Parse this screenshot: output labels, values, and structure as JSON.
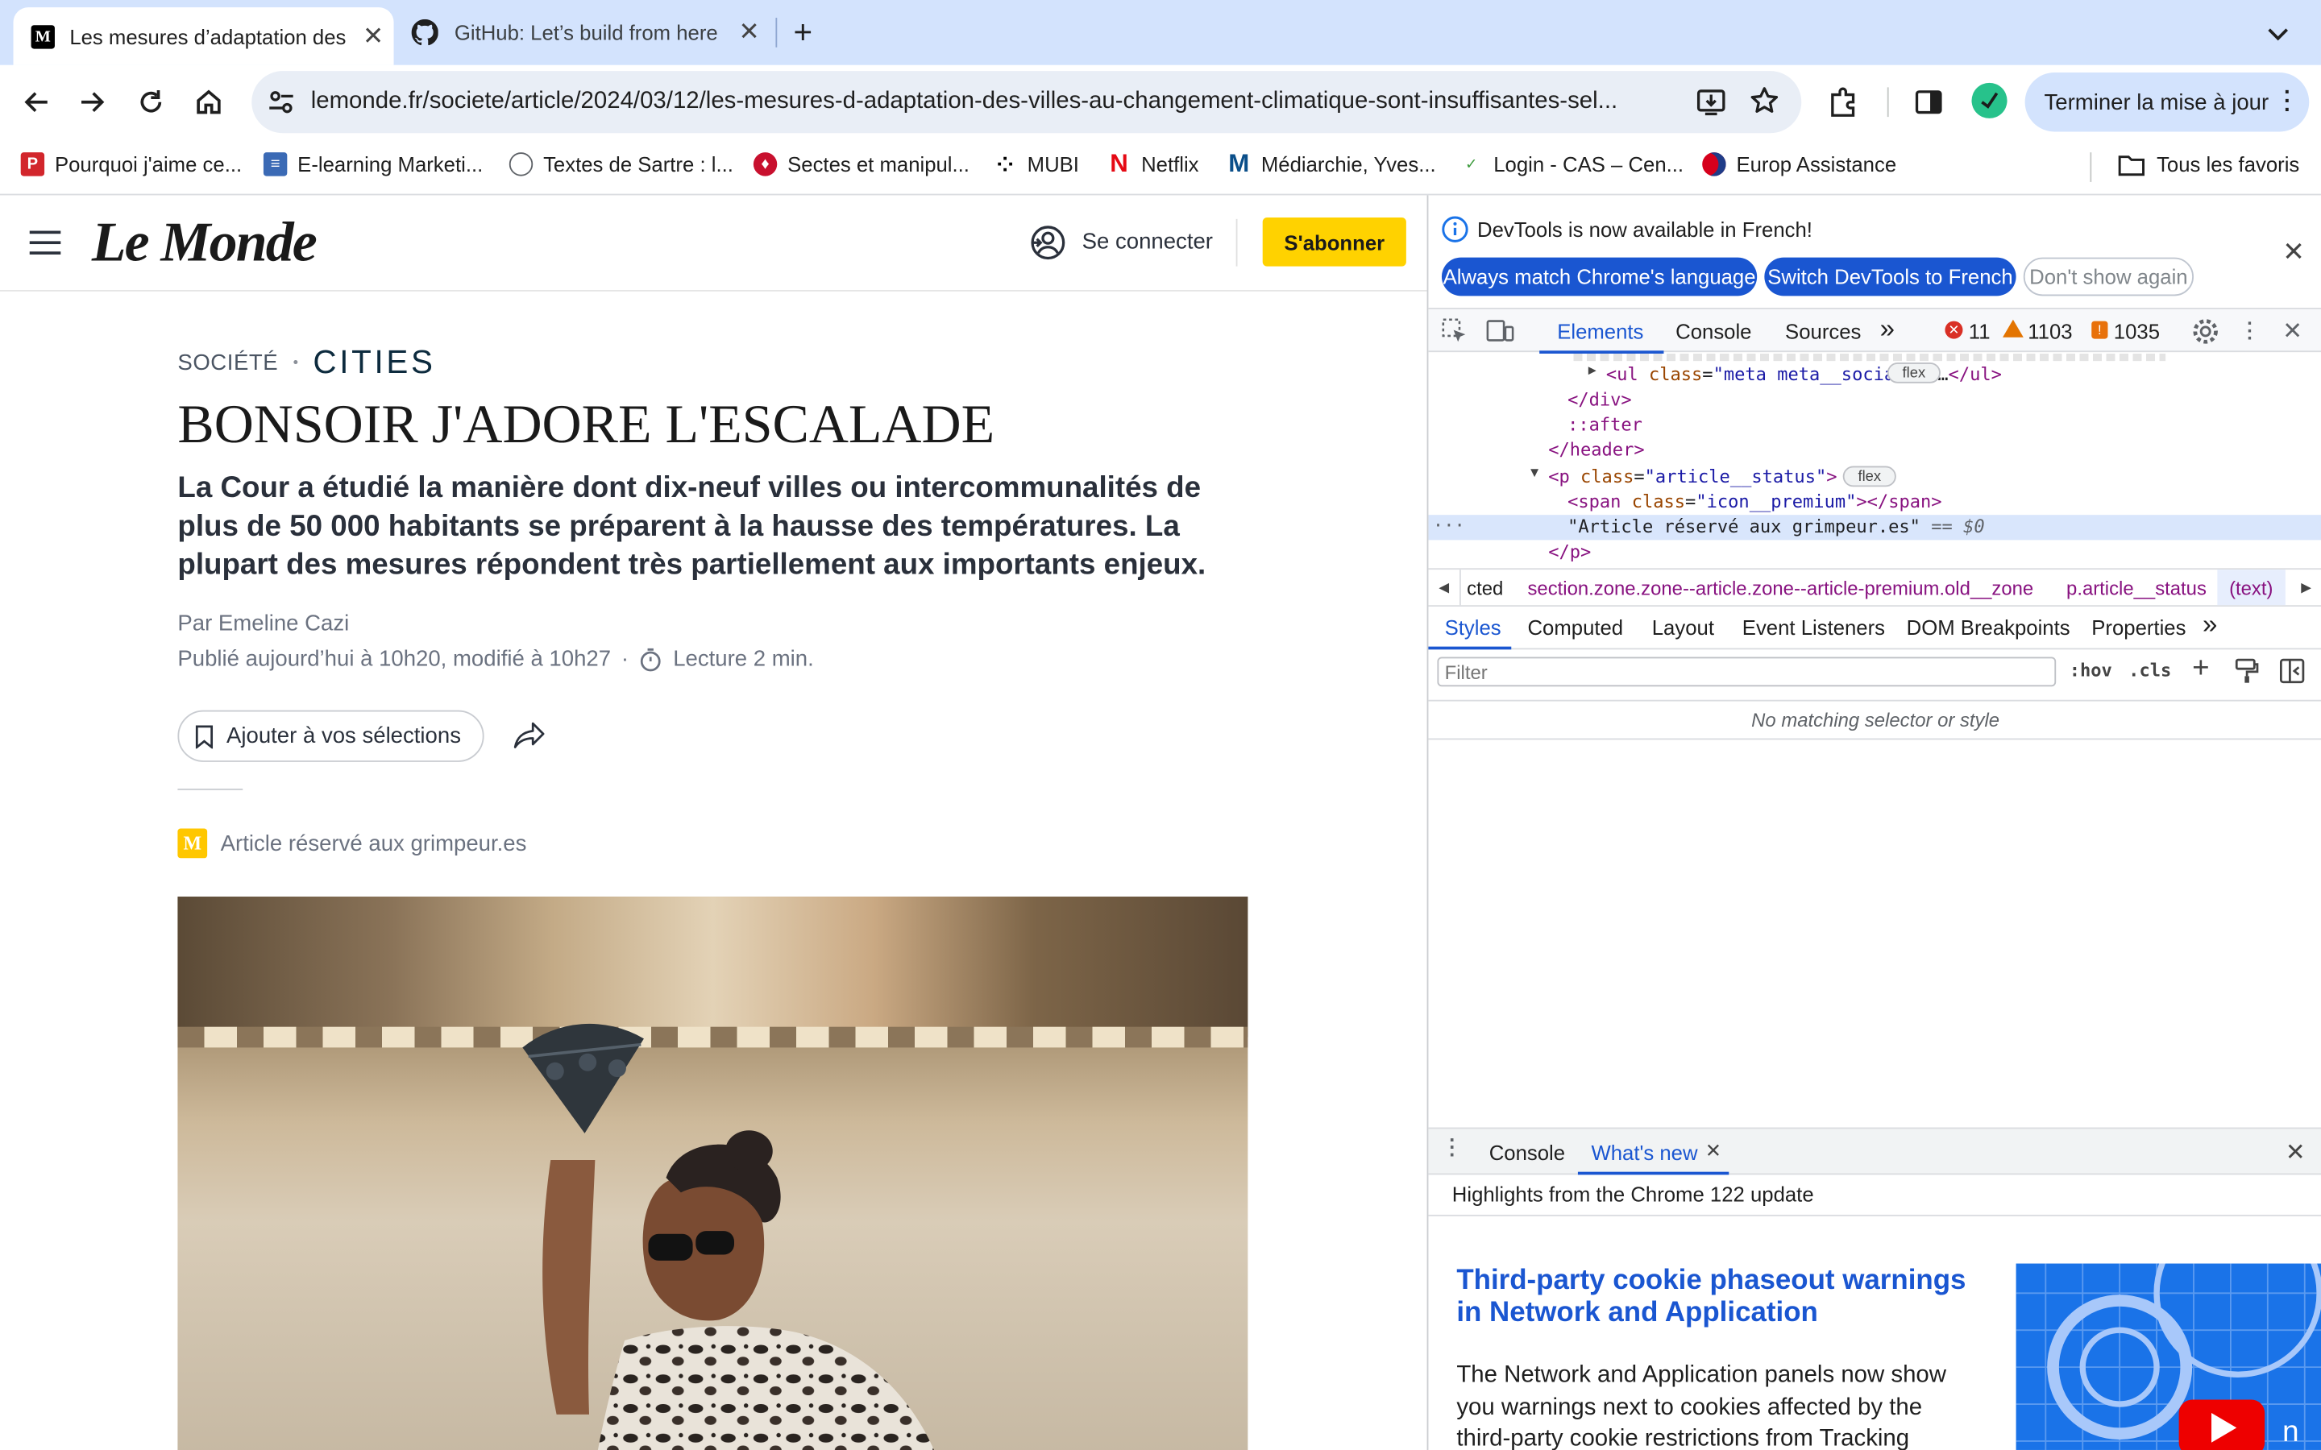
{
  "browser": {
    "tabs": [
      {
        "title": "Les mesures d’adaptation des villes au changement climatique",
        "favicon": "M"
      },
      {
        "title": "GitHub: Let’s build from here · GitHub"
      }
    ],
    "url": "lemonde.fr/societe/article/2024/03/12/les-mesures-d-adaptation-des-villes-au-changement-climatique-sont-insuffisantes-sel...",
    "update_button": "Terminer la mise à jour",
    "bookmarks": [
      "Pourquoi j'aime ce...",
      "E-learning Marketi...",
      "Textes de Sartre : l...",
      "Sectes et manipul...",
      "MUBI",
      "Netflix",
      "Médiarchie, Yves...",
      "Login - CAS – Cen...",
      "Europ Assistance"
    ],
    "all_bookmarks": "Tous les favoris"
  },
  "site": {
    "logo": "Le Monde",
    "login": "Se connecter",
    "subscribe": "S'abonner",
    "subscribe_color": "#ffd200"
  },
  "article": {
    "section": "SOCIÉTÉ",
    "separator": "•",
    "cities_logo": "CITIES",
    "title": "BONSOIR J'ADORE L'ESCALADE",
    "lead": "La Cour a étudié la manière dont dix-neuf villes ou intercommunalités de plus de 50 000 habitants se préparent à la hausse des températures. La plupart des mesures répondent très partiellement aux importants enjeux.",
    "author": "Par Emeline Cazi",
    "published": "Publié aujourd’hui à 10h20, modifié à 10h27",
    "dot": "·",
    "reading_time": "Lecture 2 min.",
    "save_button": "Ajouter à vos sélections",
    "premium_label": "Article réservé aux grimpeur.es"
  },
  "devtools": {
    "banner_text": "DevTools is now available in French!",
    "banner_buttons": [
      "Always match Chrome's language",
      "Switch DevTools to French",
      "Don't show again"
    ],
    "tabs": [
      "Elements",
      "Console",
      "Sources"
    ],
    "errors": "11",
    "warnings": "1103",
    "issues": "1035",
    "dom_lines": [
      {
        "indent": 6,
        "html": "<span class='tag'>&lt;ul</span> <span class='attr'>class</span>=<span class='aval'>\"meta meta__social  \"</span><span class='tag'>&gt;</span>…<span class='tag'>&lt;/ul&gt;</span>"
      },
      {
        "indent": 4,
        "html": "<span class='tag'>&lt;/div&gt;</span>"
      },
      {
        "indent": 4,
        "html": "<span class='tag'>::after</span>"
      },
      {
        "indent": 3,
        "html": "<span class='tag'>&lt;/header&gt;</span>"
      },
      {
        "indent": 3,
        "html": "<span class='tag'>&lt;p</span> <span class='attr'>class</span>=<span class='aval'>\"article__status\"</span><span class='tag'>&gt;</span>"
      },
      {
        "indent": 4,
        "html": "<span class='tag'>&lt;span</span> <span class='attr'>class</span>=<span class='aval'>\"icon__premium\"</span><span class='tag'>&gt;&lt;/span&gt;</span>"
      },
      {
        "indent": 4,
        "html": "\"Article réservé aux grimpeur.es\" <span style='color:#5f6368'>== <i>$0</i></span>"
      },
      {
        "indent": 3,
        "html": "<span class='tag'>&lt;/p&gt;</span>"
      }
    ],
    "flex_badge": "flex",
    "breadcrumbs": [
      "cted",
      "section.zone.zone--article.zone--article-premium.old__zone",
      "p.article__status",
      "(text)"
    ],
    "style_tabs": [
      "Styles",
      "Computed",
      "Layout",
      "Event Listeners",
      "DOM Breakpoints",
      "Properties"
    ],
    "filter_placeholder": "Filter",
    "hov": ":hov",
    "cls": ".cls",
    "no_match": "No matching selector or style",
    "drawer_tabs": [
      "Console",
      "What's new"
    ],
    "drawer_highlight": "Highlights from the Chrome 122 update",
    "whatsnew_title": "Third-party cookie phaseout warnings in Network and Application",
    "whatsnew_body": "The Network and Application panels now show you warnings next to cookies affected by the third-party cookie restrictions from Tracking"
  }
}
